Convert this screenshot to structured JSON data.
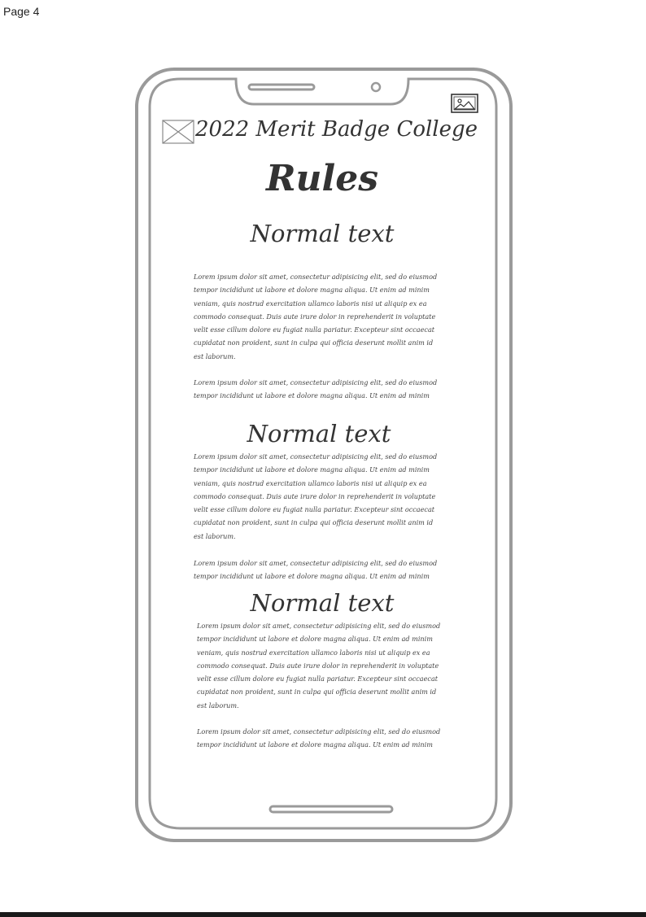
{
  "page": {
    "label": "Page 4"
  },
  "app": {
    "header_title": "2022 Merit Badge College",
    "page_title": "Rules",
    "menu_icon": "menu-placeholder-icon",
    "image_icon": "image-icon"
  },
  "sections": [
    {
      "heading": "Normal text",
      "paragraphs": [
        "Lorem ipsum dolor sit amet, consectetur adipisicing elit, sed do eiusmod\ntempor incididunt ut labore et dolore magna aliqua. Ut enim ad minim\nveniam, quis nostrud exercitation ullamco laboris nisi ut aliquip ex ea\ncommodo consequat. Duis aute irure dolor in reprehenderit in voluptate\nvelit esse cillum dolore eu fugiat nulla pariatur. Excepteur sint occaecat\ncupidatat non proident, sunt in culpa qui officia deserunt mollit anim id\nest laborum.",
        "Lorem ipsum dolor sit amet, consectetur adipisicing elit, sed do eiusmod\ntempor incididunt ut labore et dolore magna aliqua. Ut enim ad minim"
      ]
    },
    {
      "heading": "Normal text",
      "paragraphs": [
        "Lorem ipsum dolor sit amet, consectetur adipisicing elit, sed do eiusmod\ntempor incididunt ut labore et dolore magna aliqua. Ut enim ad minim\nveniam, quis nostrud exercitation ullamco laboris nisi ut aliquip ex ea\ncommodo consequat. Duis aute irure dolor in reprehenderit in voluptate\nvelit esse cillum dolore eu fugiat nulla pariatur. Excepteur sint occaecat\ncupidatat non proident, sunt in culpa qui officia deserunt mollit anim id\nest laborum.",
        "Lorem ipsum dolor sit amet, consectetur adipisicing elit, sed do eiusmod\ntempor incididunt ut labore et dolore magna aliqua. Ut enim ad minim"
      ]
    },
    {
      "heading": "Normal text",
      "paragraphs": [
        "Lorem ipsum dolor sit amet, consectetur adipisicing elit, sed do eiusmod\ntempor incididunt ut labore et dolore magna aliqua. Ut enim ad minim\nveniam, quis nostrud exercitation ullamco laboris nisi ut aliquip ex ea\ncommodo consequat. Duis aute irure dolor in reprehenderit in voluptate\nvelit esse cillum dolore eu fugiat nulla pariatur. Excepteur sint occaecat\ncupidatat non proident, sunt in culpa qui officia deserunt mollit anim id\nest laborum.",
        "Lorem ipsum dolor sit amet, consectetur adipisicing elit, sed do eiusmod\ntempor incididunt ut labore et dolore magna aliqua. Ut enim ad minim"
      ]
    }
  ]
}
